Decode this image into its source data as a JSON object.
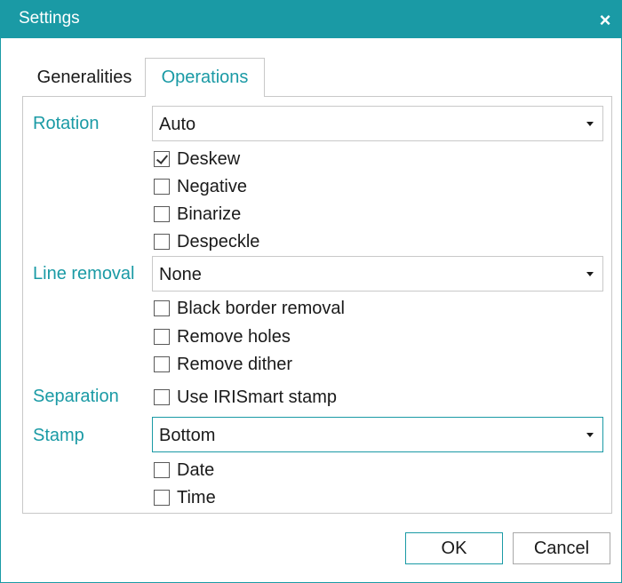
{
  "window": {
    "title": "Settings",
    "close_glyph": "×",
    "close_icon": "close-icon"
  },
  "tabs": [
    {
      "label": "Generalities",
      "active": false
    },
    {
      "label": "Operations",
      "active": true
    }
  ],
  "rotation": {
    "label": "Rotation",
    "value": "Auto",
    "options": [
      {
        "label": "Deskew",
        "checked": true
      },
      {
        "label": "Negative",
        "checked": false
      },
      {
        "label": "Binarize",
        "checked": false
      },
      {
        "label": "Despeckle",
        "checked": false
      }
    ]
  },
  "line_removal": {
    "label": "Line removal",
    "value": "None",
    "options": [
      {
        "label": "Black border removal",
        "checked": false
      },
      {
        "label": "Remove holes",
        "checked": false
      },
      {
        "label": "Remove dither",
        "checked": false
      }
    ]
  },
  "separation": {
    "label": "Separation",
    "option": {
      "label": "Use IRISmart stamp",
      "checked": false
    }
  },
  "stamp": {
    "label": "Stamp",
    "value": "Bottom",
    "options": [
      {
        "label": "Date",
        "checked": false
      },
      {
        "label": "Time",
        "checked": false
      }
    ]
  },
  "buttons": {
    "ok": "OK",
    "cancel": "Cancel"
  },
  "colors": {
    "accent": "#1a9aa5",
    "border": "#c8c8c8",
    "text": "#1a1a1a"
  }
}
